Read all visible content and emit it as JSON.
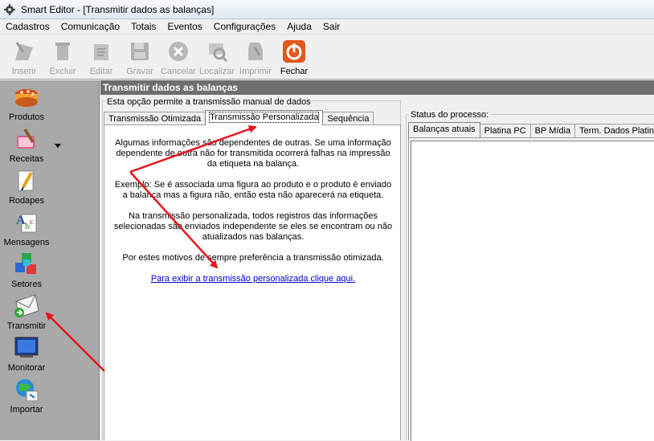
{
  "window": {
    "title": "Smart Editor - [Transmitir dados as balanças]"
  },
  "menu": [
    "Cadastros",
    "Comunicação",
    "Totais",
    "Eventos",
    "Configurações",
    "Ajuda",
    "Sair"
  ],
  "toolbar": {
    "inserir": "Inserir",
    "excluir": "Excluir",
    "editar": "Editar",
    "gravar": "Gravar",
    "cancelar": "Cancelar",
    "localizar": "Localizar",
    "imprimir": "Imprimir",
    "fechar": "Fechar"
  },
  "sidebar": {
    "produtos": "Produtos",
    "receitas": "Receitas",
    "rodapes": "Rodapes",
    "mensagens": "Mensagens",
    "setores": "Setores",
    "transmitir": "Transmitir",
    "monitorar": "Monitorar",
    "importar": "Importar"
  },
  "panel": {
    "header": "Transmitir dados as balanças",
    "group_left": "Esta opção permite a transmissão manual de dados",
    "tabs_left": [
      "Transmissão Otimizada",
      "Transmissão Personalizada",
      "Sequência"
    ],
    "paragraphs": [
      "Algumas informações são dependentes de outras. Se uma informação dependente de outra não for transmitida ocorrerá falhas na impressão da etiqueta na balança.",
      "Exemplo: Se é associada uma figura ao produto  e o produto é enviado a balança mas a figura não, então esta não aparecerá na etiqueta.",
      "Na transmissão personalizada, todos registros das informações selecionadas são enviados independente se eles se encontram ou não atualizados nas balanças.",
      "Por estes motivos de sempre preferência a transmissão otimizada."
    ],
    "link": "Para exibir a transmissão personalizada clique aqui.",
    "group_right": "Status do processo:",
    "tabs_right": [
      "Balanças atuais",
      "Platina PC",
      "BP Mídia",
      "Term. Dados Platina"
    ]
  },
  "colors": {
    "annotation_arrow": "#e8141b",
    "panel_header": "#6e6e6e",
    "sidebar": "#a9a9a9",
    "link": "#0000cc"
  }
}
